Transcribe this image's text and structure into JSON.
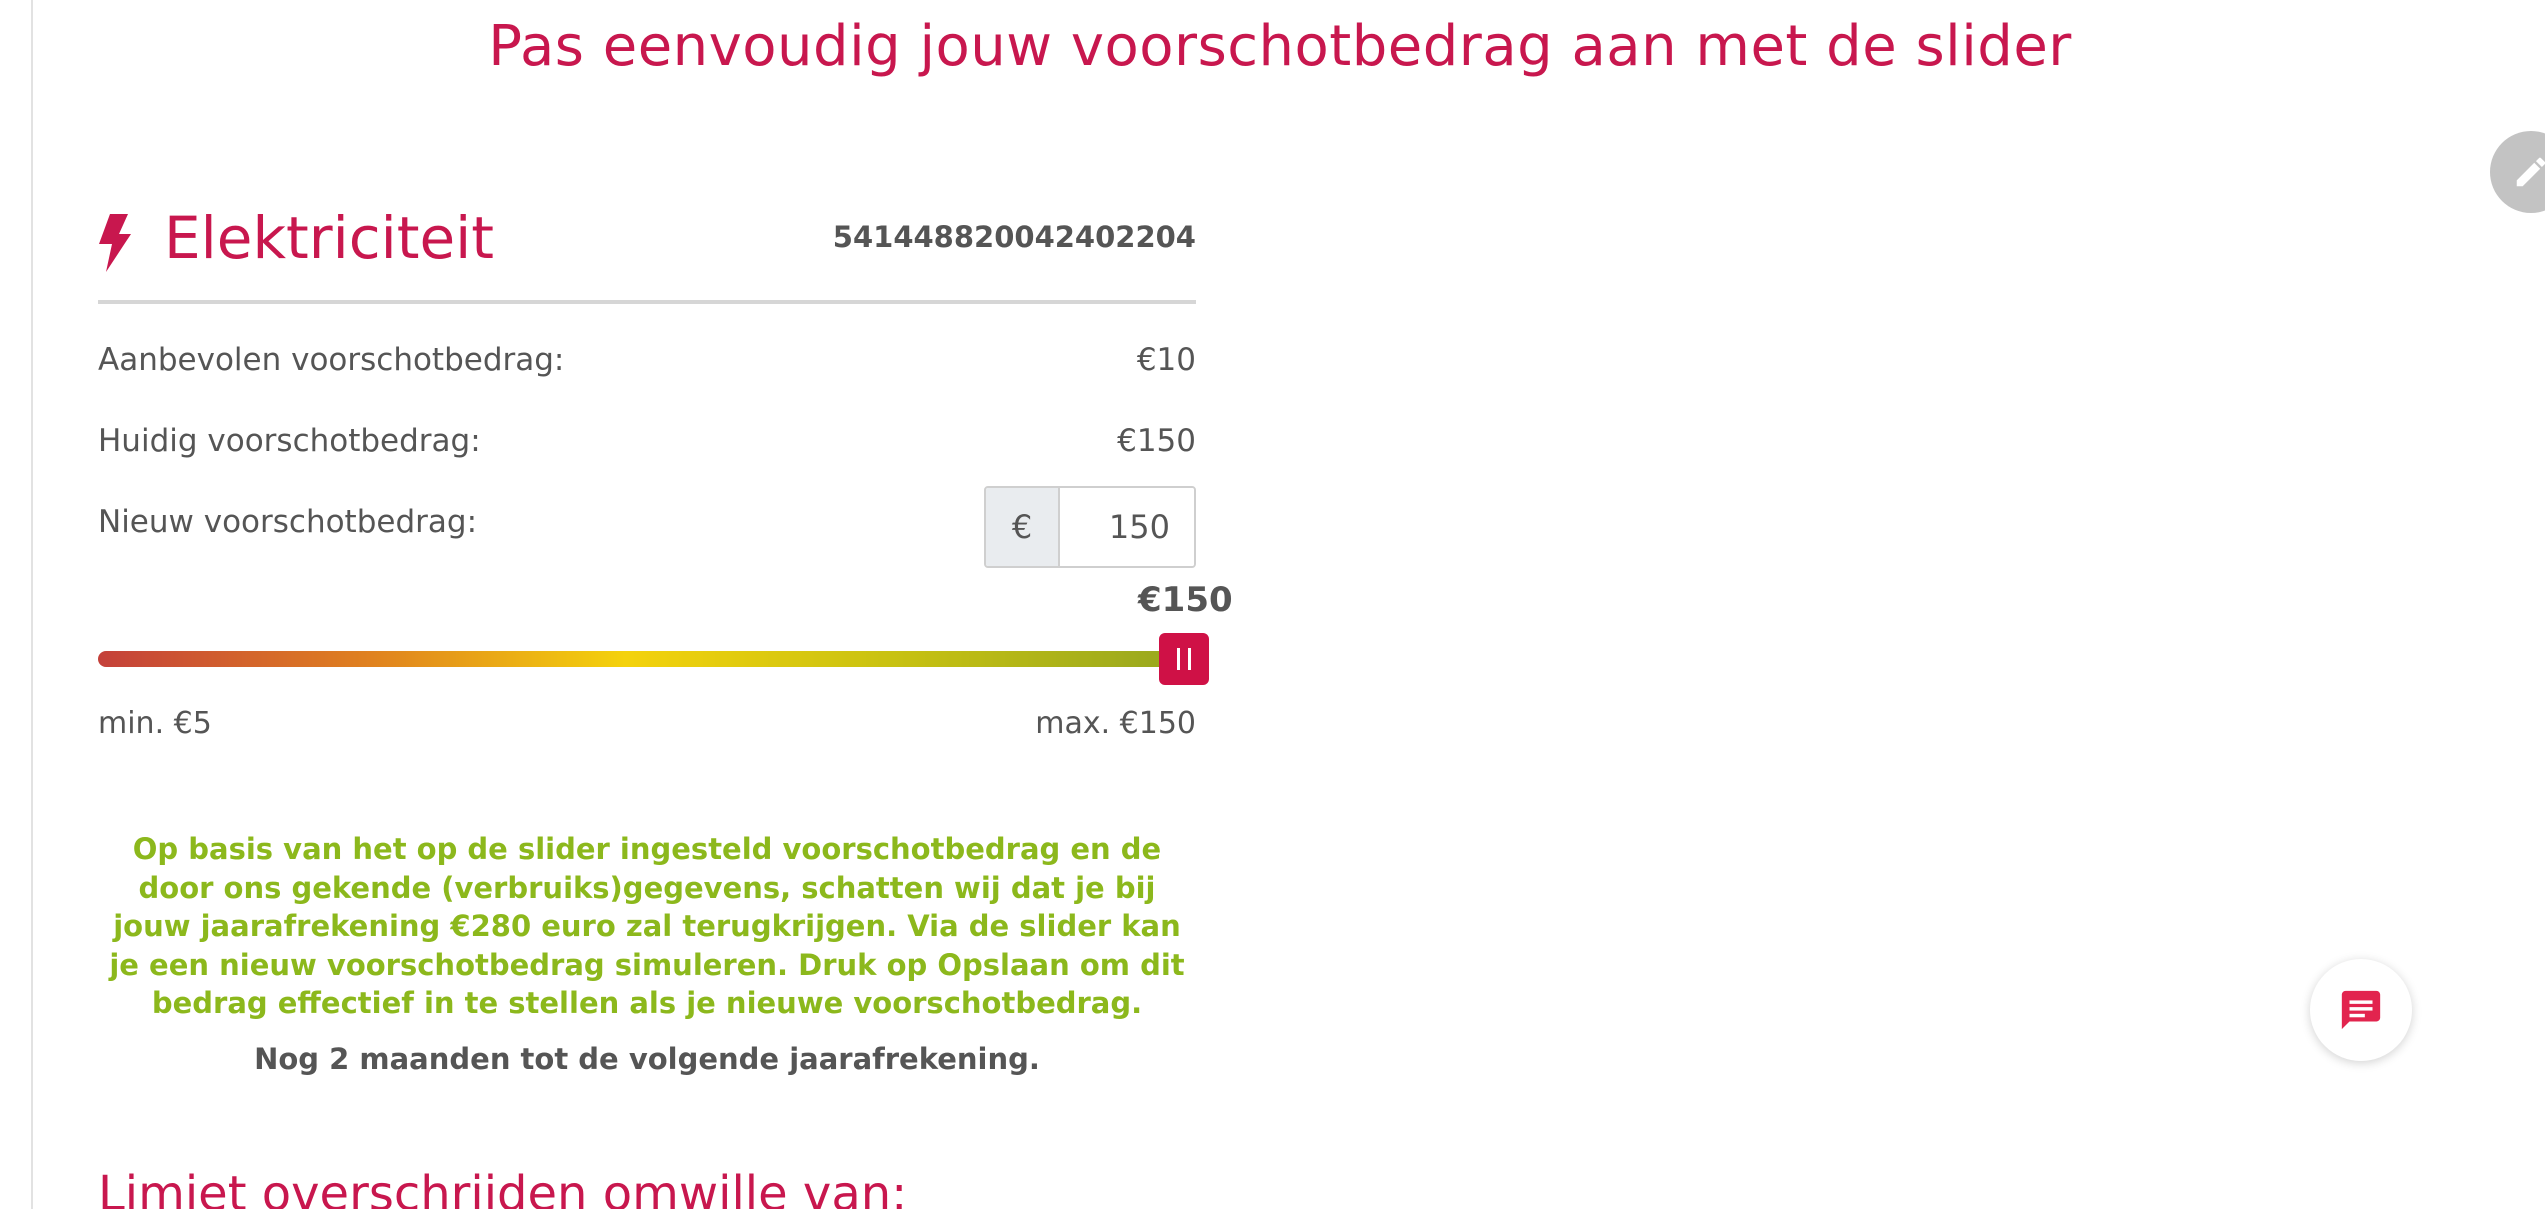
{
  "page": {
    "title": "Pas eenvoudig jouw voorschotbedrag aan met de slider"
  },
  "icons": {
    "edit": "pencil-icon",
    "energy": "lightning-bolt-icon",
    "chat": "chat-icon"
  },
  "colors": {
    "brand": "#c8174e",
    "info_green": "#8cb81c",
    "text": "#555555",
    "slider_thumb": "#cf1146"
  },
  "card": {
    "title": "Elektriciteit",
    "ean": "541448820042402204",
    "recommended": {
      "label": "Aanbevolen voorschotbedrag:",
      "value": "€10"
    },
    "current": {
      "label": "Huidig voorschotbedrag:",
      "value": "€150"
    },
    "new": {
      "label": "Nieuw voorschotbedrag:",
      "currency": "€",
      "value": "150"
    },
    "slider": {
      "value_label": "€150",
      "min_label": "min. €5",
      "max_label": "max. €150",
      "min": 5,
      "max": 150,
      "value": 150
    },
    "info": "Op basis van het op de slider ingesteld voorschotbedrag en de door ons gekende (verbruiks)gegevens, schatten wij dat je bij jouw jaarafrekening €280 euro zal terugkrijgen. Via de slider kan je een nieuw voorschotbedrag simuleren. Druk op Opslaan om dit bedrag effectief in te stellen als je nieuwe voorschotbedrag.",
    "notice": "Nog 2 maanden tot de volgende jaarafrekening."
  },
  "limit": {
    "heading": "Limiet overschrijden omwille van:"
  }
}
